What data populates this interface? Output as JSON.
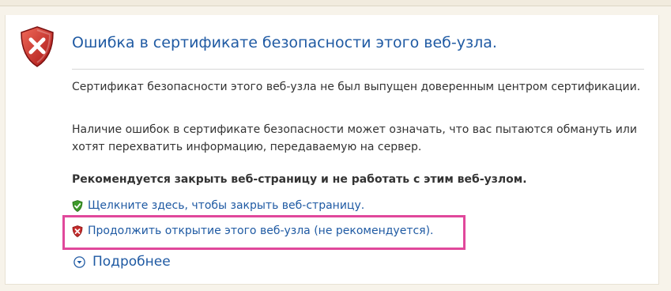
{
  "page": {
    "title": "Ошибка в сертификате безопасности этого веб-узла.",
    "paragraph1": "Сертификат безопасности этого веб-узла не был выпущен доверенным центром сертификации.",
    "paragraph2": "Наличие ошибок в сертификате безопасности может означать, что вас пытаются обмануть или хотят перехватить информацию, передаваемую на сервер.",
    "recommendation": "Рекомендуется закрыть веб-страницу и не работать с этим веб-узлом.",
    "close_link": "Щелкните здесь, чтобы закрыть веб-страницу.",
    "continue_link": "Продолжить открытие этого веб-узла (не рекомендуется).",
    "more_info": "Подробнее"
  },
  "icons": {
    "main": "red-shield-x-icon",
    "close": "green-shield-check-icon",
    "continue": "red-shield-x-icon",
    "more": "chevron-down-circle-icon"
  },
  "colors": {
    "link": "#1f5aa3",
    "highlight": "#e0489b",
    "error": "#c42b2b",
    "ok": "#3d9a2a"
  }
}
